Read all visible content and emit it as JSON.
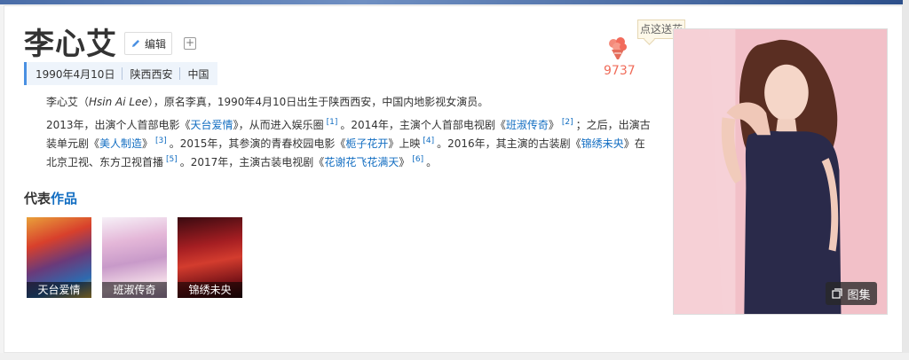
{
  "person": {
    "name": "李心艾",
    "edit_label": "编辑",
    "add_label": "+",
    "meta": [
      "1990年4月10日",
      "陕西西安",
      "中国"
    ]
  },
  "summary": {
    "p1_pre": "李心艾（",
    "p1_en": "Hsin Ai Lee",
    "p1_post": "），原名李真，1990年4月10日出生于陕西西安，中国内地影视女演员。",
    "p2": [
      {
        "t": "2013年，出演个人首部电影《"
      },
      {
        "a": "天台爱情"
      },
      {
        "t": "》，从而进入娱乐圈"
      },
      {
        "s": "[1]"
      },
      {
        "t": "。2014年，主演个人首部电视剧《"
      },
      {
        "a": "班淑传奇"
      },
      {
        "t": "》"
      },
      {
        "s": "[2]"
      },
      {
        "t": "；之后，出演古装单元剧《"
      },
      {
        "a": "美人制造"
      },
      {
        "t": "》"
      },
      {
        "s": "[3]"
      },
      {
        "t": "。2015年，其参演的青春校园电影《"
      },
      {
        "a": "栀子花开"
      },
      {
        "t": "》上映"
      },
      {
        "s": "[4]"
      },
      {
        "t": "。2016年，其主演的古装剧《"
      },
      {
        "a": "锦绣未央"
      },
      {
        "t": "》在北京卫视、东方卫视首播"
      },
      {
        "s": "[5]"
      },
      {
        "t": "。2017年，主演古装电视剧《"
      },
      {
        "a": "花谢花飞花满天"
      },
      {
        "t": "》"
      },
      {
        "s": "[6]"
      },
      {
        "t": "。"
      }
    ]
  },
  "works": {
    "title_a": "代表",
    "title_b": "作品",
    "items": [
      {
        "label": "天台爱情"
      },
      {
        "label": "班淑传奇"
      },
      {
        "label": "锦绣未央"
      }
    ]
  },
  "flowers": {
    "count": "9737",
    "tip": "点这送花",
    "icon": "flower-bouquet-icon",
    "color": "#f06c5a"
  },
  "gallery": {
    "label": "图集",
    "icon": "gallery-icon"
  },
  "colors": {
    "link": "#136ec2",
    "accent": "#4a90e2"
  }
}
